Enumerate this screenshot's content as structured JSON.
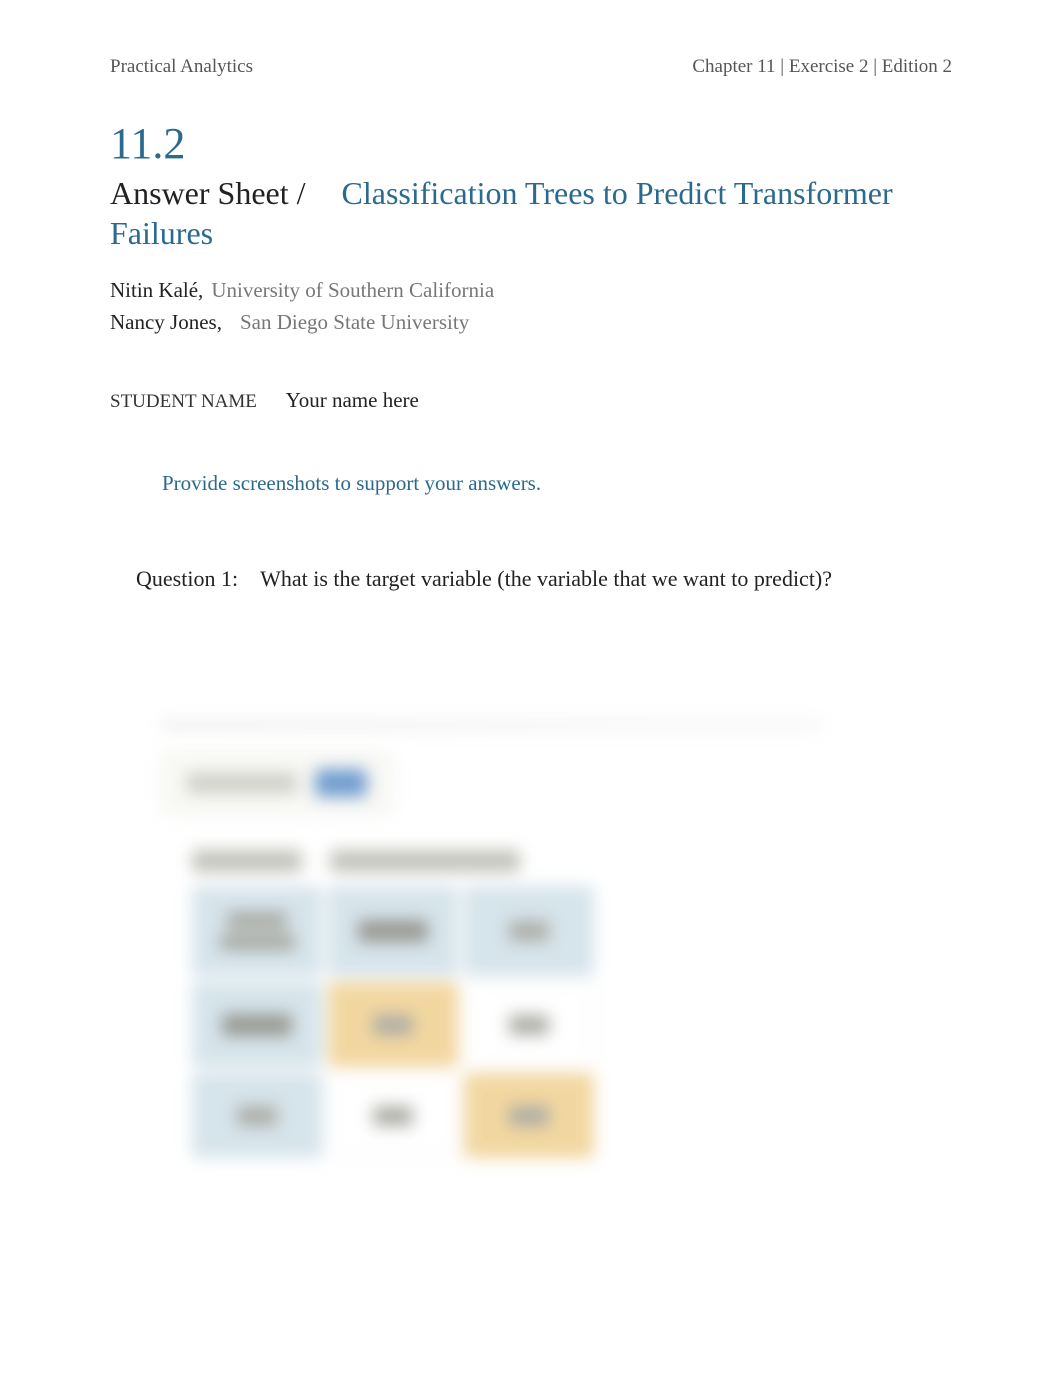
{
  "header": {
    "left": "Practical Analytics",
    "right": "Chapter 11 | Exercise 2 | Edition 2"
  },
  "section_number": "11.2",
  "title": {
    "answer_sheet": "Answer Sheet",
    "slash": " / ",
    "topic": "Classification Trees to Predict Transformer Failures"
  },
  "authors": [
    {
      "name": "Nitin Kalé,",
      "affiliation": "University of Southern California"
    },
    {
      "name": "Nancy Jones,",
      "affiliation": "San Diego State University"
    }
  ],
  "student": {
    "label": "STUDENT NAME",
    "value": "Your name here"
  },
  "instruction": "Provide screenshots to support your answers.",
  "question": {
    "label": "Question 1:",
    "text": "What is the target variable (the variable that we want to predict)?"
  }
}
